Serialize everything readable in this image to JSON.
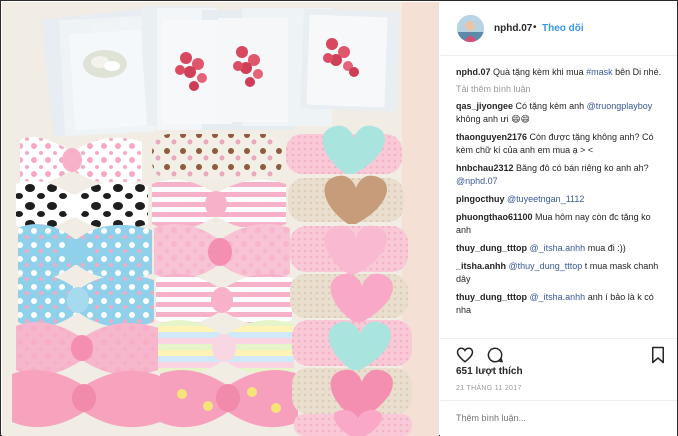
{
  "post": {
    "username": "nphd.07",
    "separator": "•",
    "follow_label": "Theo dõi",
    "more_label": "•••",
    "caption": {
      "user": "nphd.07",
      "text_before": "Quà tặng kèm khi mua",
      "hashtag": "#mask",
      "text_after": "bên Di nhé."
    },
    "load_more": "Tải thêm bình luận",
    "comments": [
      {
        "user": "qas_jiyongee",
        "text": "Có tặng kèm anh",
        "mention": "@truongplayboy",
        "after": "không anh ưi 😄😄"
      },
      {
        "user": "thaonguyen2176",
        "text": "Còn được tặng không anh? Có kèm chữ kí của anh em mua ạ > <",
        "mention": "",
        "after": ""
      },
      {
        "user": "hnbchau2312",
        "text": "Băng đô có bán riêng ko anh ah?",
        "mention": "@nphd.07",
        "after": ""
      },
      {
        "user": "plngocthuy",
        "text": "",
        "mention": "@tuyeetngan_1112",
        "after": ""
      },
      {
        "user": "phuongthao61100",
        "text": "Mua hôm nay còn đc tặng ko anh",
        "mention": "",
        "after": ""
      },
      {
        "user": "thuy_dung_tttop",
        "text": "",
        "mention": "@_itsha.anhh",
        "after": "mua đi :))"
      },
      {
        "user": "_itsha.anhh",
        "text": "",
        "mention": "@thuy_dung_tttop",
        "after": "t mua mask chanh dây"
      },
      {
        "user": "thuy_dung_tttop",
        "text": "",
        "mention": "@_itsha.anhh",
        "after": "anh í bảo là k có nha"
      }
    ],
    "likes": "651 lượt thích",
    "date": "21 THÁNG 11 2017",
    "comment_placeholder": "Thêm bình luận..."
  },
  "photo": {
    "description_colors": {
      "floor": "#f2eee8",
      "mask_pack": "#e8eef3",
      "pink": "#f7a9c4",
      "blue": "#8fd0ea",
      "cream": "#eadfcf",
      "heart_mint": "#a9e4de",
      "heart_pink": "#f9a8c8",
      "heart_brown": "#c79c7a"
    }
  },
  "colors": {
    "accent": "#3897f0",
    "mention": "#3b5998",
    "text": "#262626",
    "muted": "#999999"
  }
}
